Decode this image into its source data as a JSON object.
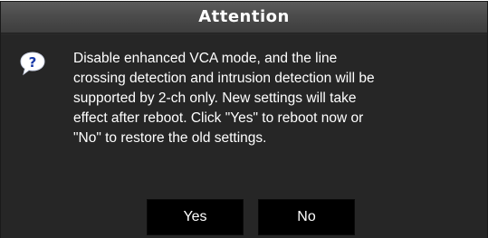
{
  "dialog": {
    "title": "Attention",
    "icon": "question-bubble-icon",
    "message_lines": [
      "Disable enhanced VCA mode, and the line",
      "crossing detection and intrusion detection will be",
      "supported by 2-ch only. New settings will take",
      "effect after reboot. Click \"Yes\" to reboot now or",
      "\"No\" to restore the old settings."
    ],
    "buttons": {
      "yes_label": "Yes",
      "no_label": "No"
    }
  },
  "colors": {
    "title_bar": "#4a4a4a",
    "body_bg": "#262626",
    "button_bg": "#000000",
    "icon_bubble": "#ffffff",
    "icon_mark": "#1a3aa8"
  }
}
